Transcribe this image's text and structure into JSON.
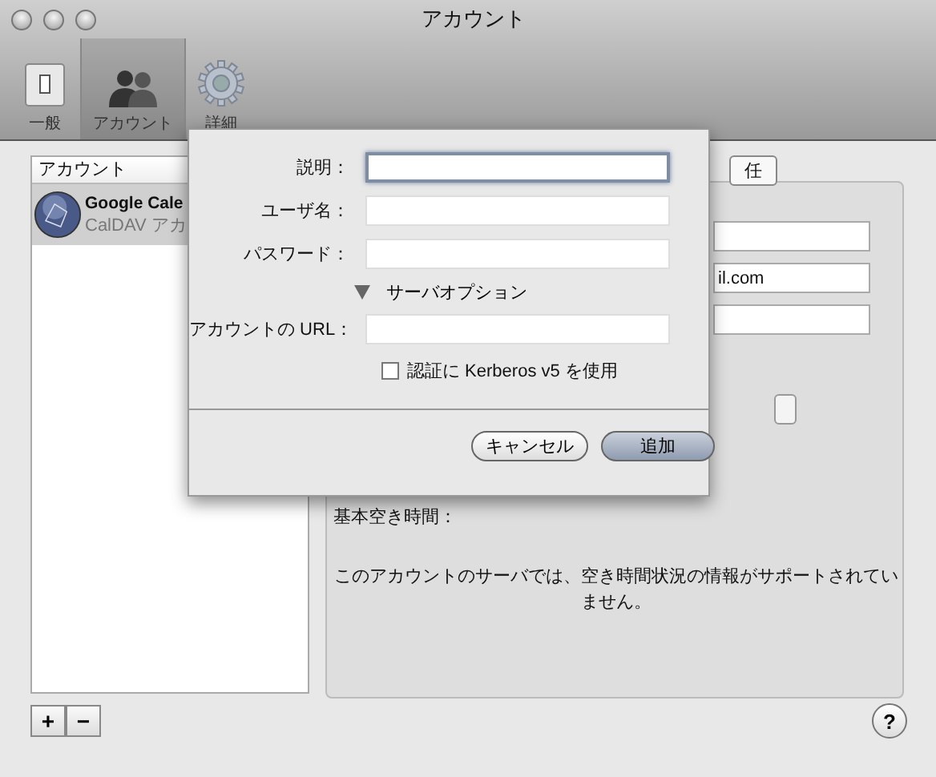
{
  "window": {
    "title": "アカウント"
  },
  "toolbar": [
    {
      "label": "一般",
      "kind": "switch",
      "selected": false
    },
    {
      "label": "アカウント",
      "kind": "people",
      "selected": true
    },
    {
      "label": "詳細",
      "kind": "gear",
      "selected": false
    }
  ],
  "accounts": {
    "header": "アカウント",
    "items": [
      {
        "name": "Google Cale",
        "type": "CalDAV アカ",
        "selected": true
      }
    ]
  },
  "detail": {
    "tab": "任",
    "email_field": "il.com",
    "availability_label": "基本空き時間：",
    "message": "このアカウントのサーバでは、空き時間状況の情報がサポートされていません。"
  },
  "list_buttons": [
    "+",
    "−"
  ],
  "help": "?",
  "sheet": {
    "fields": [
      {
        "label": "説明：",
        "focused": true
      },
      {
        "label": "ユーザ名：",
        "focused": false
      },
      {
        "label": "パスワード：",
        "focused": false
      }
    ],
    "server_options": {
      "label": "サーバオプション",
      "expanded": true
    },
    "url_field": {
      "label": "アカウントの URL：",
      "focused": false
    },
    "kerberos": {
      "label": "認証に Kerberos v5 を使用",
      "checked": false
    },
    "buttons": [
      {
        "label": "キャンセル",
        "default": false
      },
      {
        "label": "追加",
        "default": true
      }
    ]
  }
}
